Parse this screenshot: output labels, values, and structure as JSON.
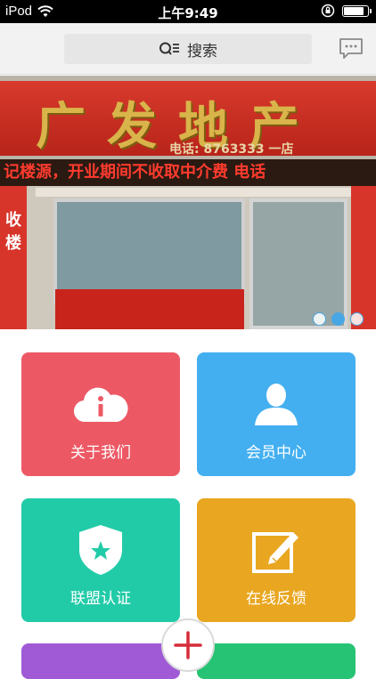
{
  "status_bar": {
    "carrier": "iPod",
    "time": "上午9:49",
    "battery_level": 0.9
  },
  "header": {
    "search_label": "搜索"
  },
  "banner": {
    "sign_title": "广发地产",
    "sign_phone": "电话: 8763333 一店",
    "led_text": "记楼源，开业期间不收取中介费 电话",
    "pillar_text": "收楼",
    "slide_count": 3,
    "active_slide": 2
  },
  "tiles": [
    {
      "label": "关于我们",
      "icon": "info-cloud-icon",
      "color": "#ec5965"
    },
    {
      "label": "会员中心",
      "icon": "user-icon",
      "color": "#43aff0"
    },
    {
      "label": "联盟认证",
      "icon": "shield-star-icon",
      "color": "#22cba8"
    },
    {
      "label": "在线反馈",
      "icon": "edit-icon",
      "color": "#e9a620"
    }
  ],
  "colors": {
    "accent_blue": "#48a6e5",
    "fab_plus": "#d62b3a"
  }
}
